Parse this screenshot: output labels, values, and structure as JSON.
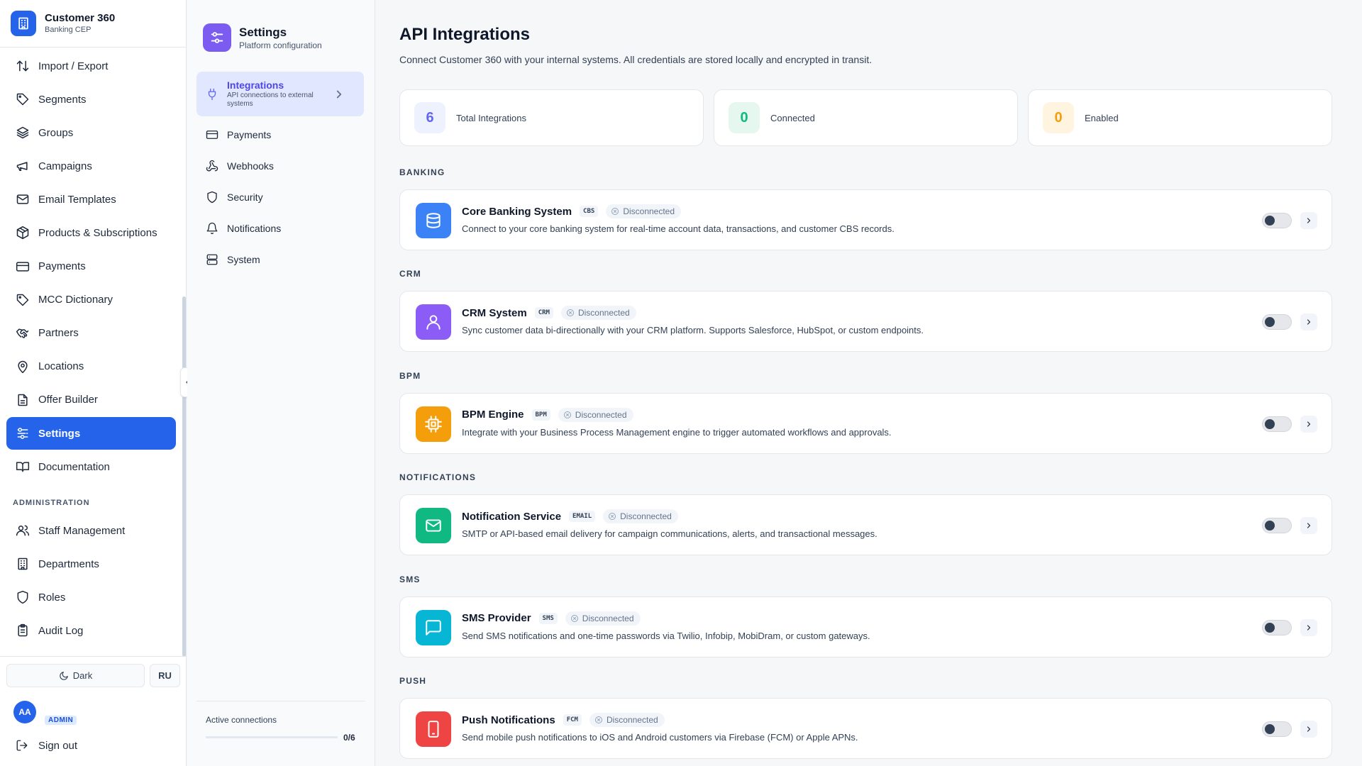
{
  "app": {
    "name": "Customer 360",
    "subtitle": "Banking CEP"
  },
  "sidebar": {
    "items": [
      {
        "label": "Import / Export",
        "icon": "import-export-icon"
      },
      {
        "label": "Segments",
        "icon": "tag-icon"
      },
      {
        "label": "Groups",
        "icon": "layers-icon"
      },
      {
        "label": "Campaigns",
        "icon": "megaphone-icon"
      },
      {
        "label": "Email Templates",
        "icon": "mail-icon"
      },
      {
        "label": "Products & Subscriptions",
        "icon": "package-icon"
      },
      {
        "label": "Payments",
        "icon": "credit-card-icon"
      },
      {
        "label": "MCC Dictionary",
        "icon": "tag-icon"
      },
      {
        "label": "Partners",
        "icon": "handshake-icon"
      },
      {
        "label": "Locations",
        "icon": "map-pin-icon"
      },
      {
        "label": "Offer Builder",
        "icon": "file-text-icon"
      },
      {
        "label": "Settings",
        "icon": "settings-icon",
        "active": true
      },
      {
        "label": "Documentation",
        "icon": "book-icon"
      }
    ],
    "admin_section": "ADMINISTRATION",
    "admin_items": [
      {
        "label": "Staff Management",
        "icon": "users-icon"
      },
      {
        "label": "Departments",
        "icon": "building-icon"
      },
      {
        "label": "Roles",
        "icon": "shield-icon"
      },
      {
        "label": "Audit Log",
        "icon": "clipboard-icon"
      }
    ],
    "theme_label": "Dark",
    "lang_label": "RU",
    "user": {
      "initials": "AA",
      "role": "ADMIN"
    },
    "signout_label": "Sign out"
  },
  "settings_panel": {
    "title": "Settings",
    "subtitle": "Platform configuration",
    "active": {
      "label": "Integrations",
      "description": "API connections to external systems"
    },
    "items": [
      {
        "label": "Payments",
        "icon": "credit-card-icon"
      },
      {
        "label": "Webhooks",
        "icon": "webhook-icon"
      },
      {
        "label": "Security",
        "icon": "shield-icon"
      },
      {
        "label": "Notifications",
        "icon": "bell-icon"
      },
      {
        "label": "System",
        "icon": "server-icon"
      }
    ],
    "active_connections_label": "Active connections",
    "active_connections_value": "0/6",
    "active_connections_fraction": 0
  },
  "main": {
    "title": "API Integrations",
    "description": "Connect Customer 360 with your internal systems. All credentials are stored locally and encrypted in transit.",
    "stats": [
      {
        "value": "6",
        "label": "Total Integrations",
        "color": "#6366f1",
        "bg": "#eef2ff"
      },
      {
        "value": "0",
        "label": "Connected",
        "color": "#10b981",
        "bg": "#e6f7ef"
      },
      {
        "value": "0",
        "label": "Enabled",
        "color": "#f59e0b",
        "bg": "#fff4e0"
      }
    ],
    "sections": [
      {
        "label": "BANKING",
        "name": "Core Banking System",
        "code": "CBS",
        "status": "Disconnected",
        "description": "Connect to your core banking system for real-time account data, transactions, and customer CBS records.",
        "icon": "database-icon",
        "color": "#3b82f6"
      },
      {
        "label": "CRM",
        "name": "CRM System",
        "code": "CRM",
        "status": "Disconnected",
        "description": "Sync customer data bi-directionally with your CRM platform. Supports Salesforce, HubSpot, or custom endpoints.",
        "icon": "user-icon",
        "color": "#8b5cf6"
      },
      {
        "label": "BPM",
        "name": "BPM Engine",
        "code": "BPM",
        "status": "Disconnected",
        "description": "Integrate with your Business Process Management engine to trigger automated workflows and approvals.",
        "icon": "cpu-icon",
        "color": "#f59e0b"
      },
      {
        "label": "NOTIFICATIONS",
        "name": "Notification Service",
        "code": "EMAIL",
        "status": "Disconnected",
        "description": "SMTP or API-based email delivery for campaign communications, alerts, and transactional messages.",
        "icon": "mail-icon",
        "color": "#10b981"
      },
      {
        "label": "SMS",
        "name": "SMS Provider",
        "code": "SMS",
        "status": "Disconnected",
        "description": "Send SMS notifications and one-time passwords via Twilio, Infobip, MobiDram, or custom gateways.",
        "icon": "message-square-icon",
        "color": "#06b6d4"
      },
      {
        "label": "PUSH",
        "name": "Push Notifications",
        "code": "FCM",
        "status": "Disconnected",
        "description": "Send mobile push notifications to iOS and Android customers via Firebase (FCM) or Apple APNs.",
        "icon": "smartphone-icon",
        "color": "#ef4444"
      }
    ]
  }
}
